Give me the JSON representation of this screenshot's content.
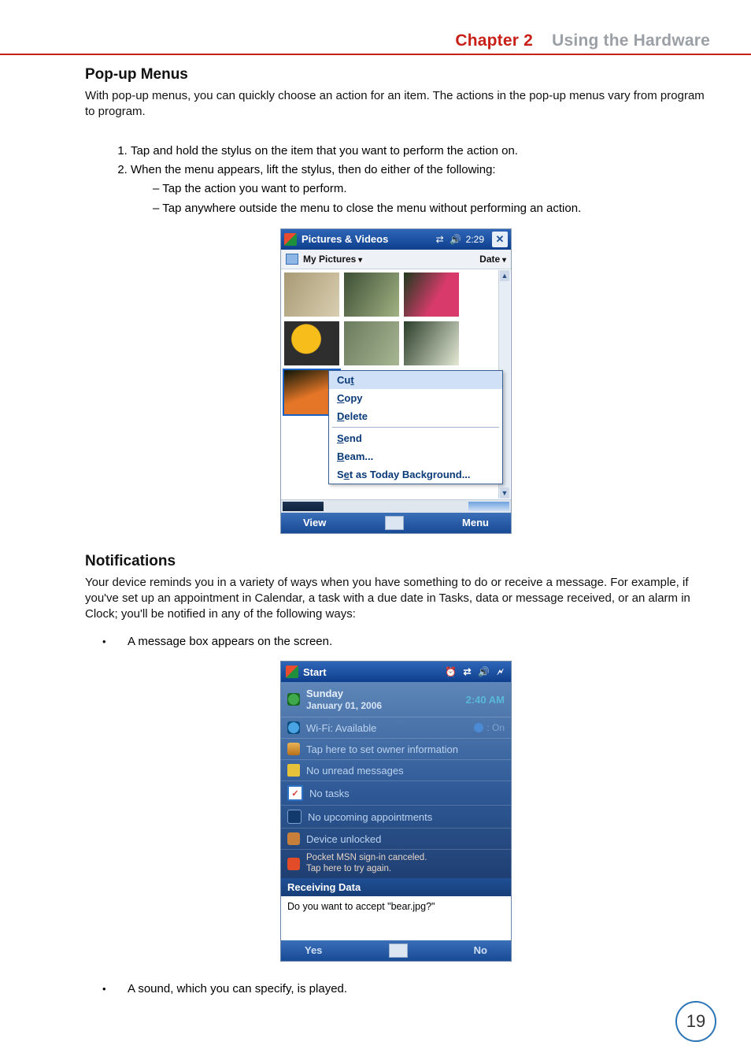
{
  "header": {
    "chapter": "Chapter 2",
    "title": "Using the Hardware"
  },
  "popup_section": {
    "heading": "Pop-up Menus",
    "intro": "With pop-up menus, you can quickly choose an action for an item. The actions in the pop-up menus vary from program to program.",
    "step1": "Tap and hold the stylus on the item that you want to perform the action on.",
    "step2": "When the menu appears, lift the stylus, then do either of the following:",
    "step2a": "Tap the action you want to perform.",
    "step2b": "Tap anywhere outside the menu to close the menu without performing an action."
  },
  "pv": {
    "title": "Pictures & Videos",
    "clock": "2:29",
    "close_glyph": "✕",
    "folder": "My Pictures",
    "sort": "Date",
    "menu": {
      "cut": "Cut",
      "copy": "Copy",
      "delete": "Delete",
      "send": "Send",
      "beam": "Beam...",
      "setbg": "Set as Today Background..."
    },
    "left_soft": "View",
    "right_soft": "Menu"
  },
  "notif_section": {
    "heading": "Notifications",
    "intro": "Your device reminds you in a variety of ways when you have something to do or receive a message. For example, if you've set up an appointment in Calendar, a task with a due date in Tasks, data or message received, or an alarm in Clock; you'll be notified in any of the following ways:",
    "bullet1": "A message box appears on the screen.",
    "bullet2": "A sound, which you can specify, is played."
  },
  "today": {
    "title": "Start",
    "day": "Sunday",
    "date": "January 01, 2006",
    "time": "2:40 AM",
    "wifi_label": "Wi-Fi: Available",
    "wifi_state": ": On",
    "owner": "Tap here to set owner information",
    "msgs": "No unread messages",
    "tasks": "No tasks",
    "appts": "No upcoming appointments",
    "lock": "Device unlocked",
    "msn1": "Pocket MSN sign-in canceled.",
    "msn2": "Tap here to try again.",
    "dlg_title": "Receiving Data",
    "dlg_msg": "Do you want to accept \"bear.jpg?\"",
    "yes": "Yes",
    "no": "No"
  },
  "page_number": "19"
}
